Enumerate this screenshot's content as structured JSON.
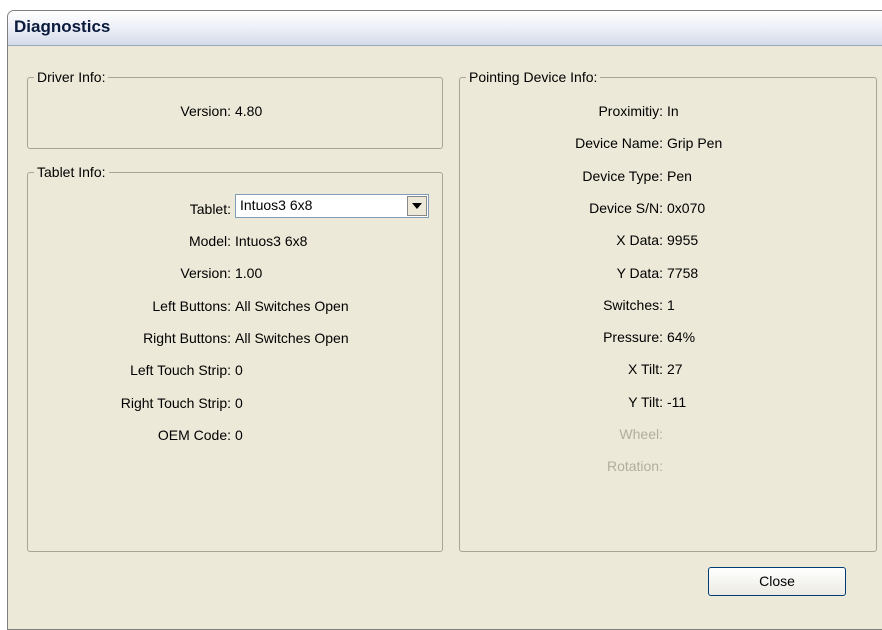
{
  "window": {
    "title": "Diagnostics"
  },
  "driver_info": {
    "legend": "Driver Info:",
    "version_label": "Version:",
    "version_value": "4.80"
  },
  "tablet_info": {
    "legend": "Tablet Info:",
    "tablet_label": "Tablet:",
    "tablet_selected": "Intuos3 6x8",
    "fields": [
      {
        "label": "Model:",
        "value": "Intuos3 6x8"
      },
      {
        "label": "Version:",
        "value": "1.00"
      },
      {
        "label": "Left Buttons:",
        "value": "All Switches Open"
      },
      {
        "label": "Right Buttons:",
        "value": "All Switches Open"
      },
      {
        "label": "Left Touch Strip:",
        "value": "0"
      },
      {
        "label": "Right Touch Strip:",
        "value": "0"
      },
      {
        "label": "OEM Code:",
        "value": "0"
      }
    ]
  },
  "pointing_info": {
    "legend": "Pointing Device Info:",
    "fields": [
      {
        "label": "Proximitiy:",
        "value": "In"
      },
      {
        "label": "Device Name:",
        "value": "Grip Pen"
      },
      {
        "label": "Device Type:",
        "value": "Pen"
      },
      {
        "label": "Device S/N:",
        "value": "0x070"
      },
      {
        "label": "X Data:",
        "value": "9955"
      },
      {
        "label": "Y Data:",
        "value": "7758"
      },
      {
        "label": "Switches:",
        "value": "1"
      },
      {
        "label": "Pressure:",
        "value": "64%"
      },
      {
        "label": "X Tilt:",
        "value": "27"
      },
      {
        "label": "Y Tilt:",
        "value": "-11"
      },
      {
        "label": "Wheel:",
        "value": ""
      },
      {
        "label": "Rotation:",
        "value": ""
      }
    ]
  },
  "buttons": {
    "close_label": "Close"
  }
}
